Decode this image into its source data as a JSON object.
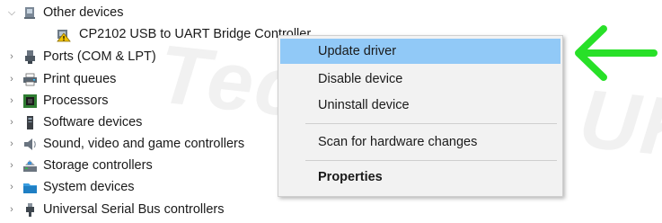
{
  "tree": {
    "other_devices": "Other devices",
    "cp2102": "CP2102 USB to UART Bridge Controller",
    "ports": "Ports (COM & LPT)",
    "print_queues": "Print queues",
    "processors": "Processors",
    "software_devices": "Software devices",
    "sound": "Sound, video and game controllers",
    "storage": "Storage controllers",
    "system": "System devices",
    "usb": "Universal Serial Bus controllers"
  },
  "menu": {
    "update_driver": "Update driver",
    "disable_device": "Disable device",
    "uninstall_device": "Uninstall device",
    "scan_hardware": "Scan for hardware changes",
    "properties": "Properties"
  },
  "watermark": "Technolix UK",
  "icons": {
    "expanded": "chevron-down-icon",
    "collapsed": "chevron-right-icon",
    "warning": "warning-device-icon",
    "arrow": "green-arrow-left-icon"
  },
  "colors": {
    "menu_highlight": "#91c9f7",
    "arrow": "#28e028"
  }
}
